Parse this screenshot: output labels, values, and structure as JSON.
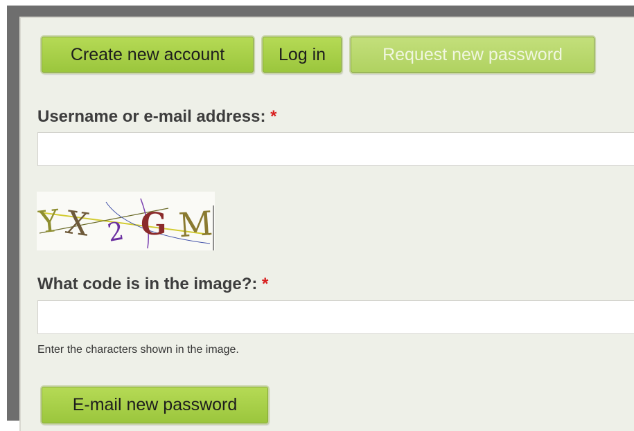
{
  "tabs": [
    {
      "label": "Create new account",
      "active": false
    },
    {
      "label": "Log in",
      "active": false
    },
    {
      "label": "Request new password",
      "active": true
    }
  ],
  "form": {
    "username_label": "Username or e-mail address:",
    "required_marker": "*",
    "username_value": "",
    "captcha_label": "What code is in the image?:",
    "captcha_value": "",
    "captcha_description": "Enter the characters shown in the image.",
    "submit_label": "E-mail new password"
  },
  "captcha_image": {
    "characters": "YX2GM"
  },
  "colors": {
    "button_green": "#a6cf48",
    "required_red": "#d81f1f",
    "panel_bg": "#eef0e8"
  }
}
